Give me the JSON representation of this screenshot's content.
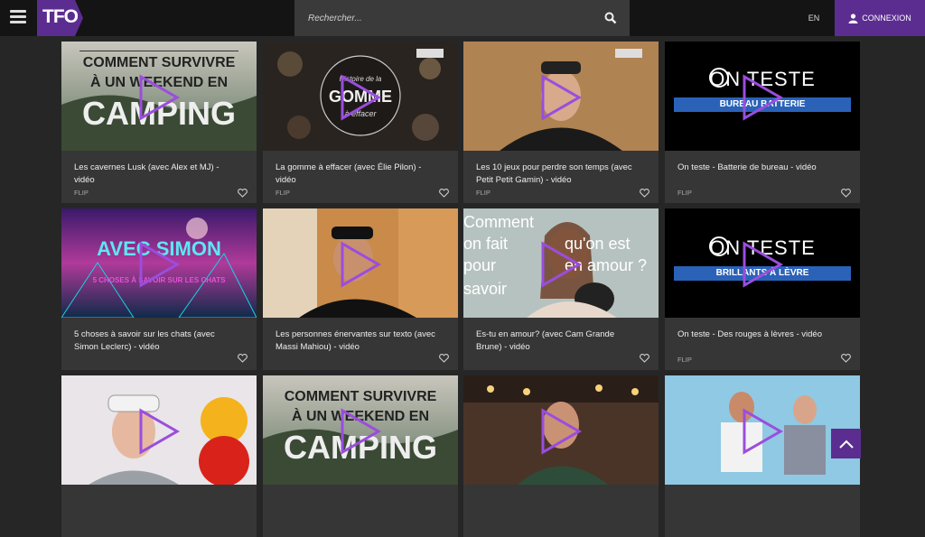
{
  "header": {
    "logo_text": "TFO",
    "search_placeholder": "Rechercher...",
    "language": "EN",
    "login_label": "CONNEXION",
    "accent": "#5c2d91"
  },
  "cards": [
    {
      "title": "Les cavernes Lusk (avec Alex et MJ) - vidéo",
      "tag": "FLIP",
      "overlay": [
        "COMMENT SURVIVRE",
        "À UN WEEKEND EN",
        "CAMPING"
      ]
    },
    {
      "title": "La gomme à effacer (avec Élie Pilon) - vidéo",
      "tag": "FLIP",
      "overlay": [
        "Histoire de la",
        "GOMME",
        "à effacer"
      ]
    },
    {
      "title": "Les 10 jeux pour perdre son temps (avec Petit Petit Gamin) - vidéo",
      "tag": "FLIP",
      "overlay": []
    },
    {
      "title": "On teste - Batterie de bureau - vidéo",
      "tag": "FLIP",
      "overlay": [
        "ON TESTE",
        "BUREAU BATTERIE"
      ]
    },
    {
      "title": "5 choses à savoir sur les chats (avec Simon Leclerc) - vidéo",
      "tag": "",
      "overlay": [
        "AVEC SIMON",
        "5 CHOSES À SAVOIR SUR LES CHATS"
      ]
    },
    {
      "title": "Les personnes énervantes sur texto (avec Massi Mahiou) - vidéo",
      "tag": "",
      "overlay": []
    },
    {
      "title": "Es-tu en amour? (avec Cam Grande Brune) - vidéo",
      "tag": "",
      "overlay": [
        "Comment",
        "on fait",
        "qu'on est",
        "pour",
        "en amour ?",
        "savoir"
      ]
    },
    {
      "title": "On teste - Des rouges à lèvres - vidéo",
      "tag": "FLIP",
      "overlay": [
        "ON TESTE",
        "BRILLANTS À LÈVRE"
      ]
    },
    {
      "title": "",
      "tag": "",
      "overlay": []
    },
    {
      "title": "",
      "tag": "",
      "overlay": [
        "COMMENT SURVIVRE",
        "À UN WEEKEND EN",
        "CAMPING"
      ]
    },
    {
      "title": "",
      "tag": "",
      "overlay": []
    },
    {
      "title": "",
      "tag": "",
      "overlay": []
    }
  ]
}
